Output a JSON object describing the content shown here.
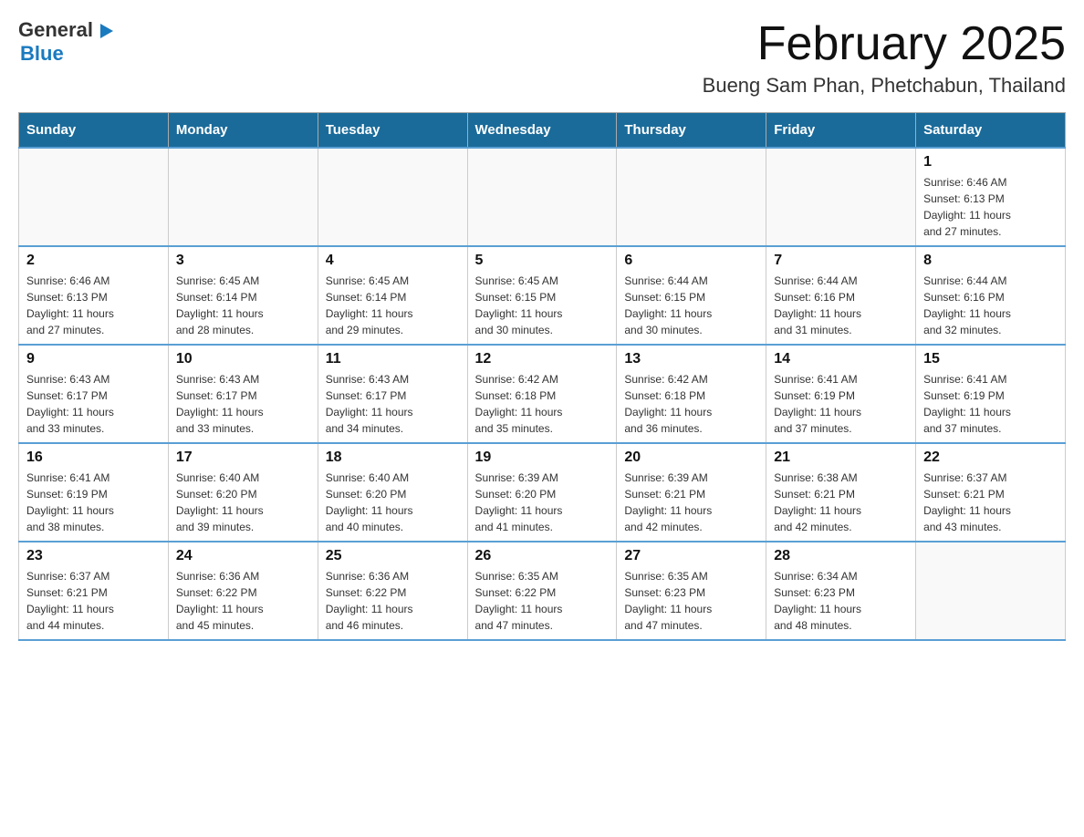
{
  "header": {
    "logo_general": "General",
    "logo_blue": "Blue",
    "month_title": "February 2025",
    "location": "Bueng Sam Phan, Phetchabun, Thailand"
  },
  "days_of_week": [
    "Sunday",
    "Monday",
    "Tuesday",
    "Wednesday",
    "Thursday",
    "Friday",
    "Saturday"
  ],
  "weeks": [
    [
      {
        "day": "",
        "info": ""
      },
      {
        "day": "",
        "info": ""
      },
      {
        "day": "",
        "info": ""
      },
      {
        "day": "",
        "info": ""
      },
      {
        "day": "",
        "info": ""
      },
      {
        "day": "",
        "info": ""
      },
      {
        "day": "1",
        "info": "Sunrise: 6:46 AM\nSunset: 6:13 PM\nDaylight: 11 hours\nand 27 minutes."
      }
    ],
    [
      {
        "day": "2",
        "info": "Sunrise: 6:46 AM\nSunset: 6:13 PM\nDaylight: 11 hours\nand 27 minutes."
      },
      {
        "day": "3",
        "info": "Sunrise: 6:45 AM\nSunset: 6:14 PM\nDaylight: 11 hours\nand 28 minutes."
      },
      {
        "day": "4",
        "info": "Sunrise: 6:45 AM\nSunset: 6:14 PM\nDaylight: 11 hours\nand 29 minutes."
      },
      {
        "day": "5",
        "info": "Sunrise: 6:45 AM\nSunset: 6:15 PM\nDaylight: 11 hours\nand 30 minutes."
      },
      {
        "day": "6",
        "info": "Sunrise: 6:44 AM\nSunset: 6:15 PM\nDaylight: 11 hours\nand 30 minutes."
      },
      {
        "day": "7",
        "info": "Sunrise: 6:44 AM\nSunset: 6:16 PM\nDaylight: 11 hours\nand 31 minutes."
      },
      {
        "day": "8",
        "info": "Sunrise: 6:44 AM\nSunset: 6:16 PM\nDaylight: 11 hours\nand 32 minutes."
      }
    ],
    [
      {
        "day": "9",
        "info": "Sunrise: 6:43 AM\nSunset: 6:17 PM\nDaylight: 11 hours\nand 33 minutes."
      },
      {
        "day": "10",
        "info": "Sunrise: 6:43 AM\nSunset: 6:17 PM\nDaylight: 11 hours\nand 33 minutes."
      },
      {
        "day": "11",
        "info": "Sunrise: 6:43 AM\nSunset: 6:17 PM\nDaylight: 11 hours\nand 34 minutes."
      },
      {
        "day": "12",
        "info": "Sunrise: 6:42 AM\nSunset: 6:18 PM\nDaylight: 11 hours\nand 35 minutes."
      },
      {
        "day": "13",
        "info": "Sunrise: 6:42 AM\nSunset: 6:18 PM\nDaylight: 11 hours\nand 36 minutes."
      },
      {
        "day": "14",
        "info": "Sunrise: 6:41 AM\nSunset: 6:19 PM\nDaylight: 11 hours\nand 37 minutes."
      },
      {
        "day": "15",
        "info": "Sunrise: 6:41 AM\nSunset: 6:19 PM\nDaylight: 11 hours\nand 37 minutes."
      }
    ],
    [
      {
        "day": "16",
        "info": "Sunrise: 6:41 AM\nSunset: 6:19 PM\nDaylight: 11 hours\nand 38 minutes."
      },
      {
        "day": "17",
        "info": "Sunrise: 6:40 AM\nSunset: 6:20 PM\nDaylight: 11 hours\nand 39 minutes."
      },
      {
        "day": "18",
        "info": "Sunrise: 6:40 AM\nSunset: 6:20 PM\nDaylight: 11 hours\nand 40 minutes."
      },
      {
        "day": "19",
        "info": "Sunrise: 6:39 AM\nSunset: 6:20 PM\nDaylight: 11 hours\nand 41 minutes."
      },
      {
        "day": "20",
        "info": "Sunrise: 6:39 AM\nSunset: 6:21 PM\nDaylight: 11 hours\nand 42 minutes."
      },
      {
        "day": "21",
        "info": "Sunrise: 6:38 AM\nSunset: 6:21 PM\nDaylight: 11 hours\nand 42 minutes."
      },
      {
        "day": "22",
        "info": "Sunrise: 6:37 AM\nSunset: 6:21 PM\nDaylight: 11 hours\nand 43 minutes."
      }
    ],
    [
      {
        "day": "23",
        "info": "Sunrise: 6:37 AM\nSunset: 6:21 PM\nDaylight: 11 hours\nand 44 minutes."
      },
      {
        "day": "24",
        "info": "Sunrise: 6:36 AM\nSunset: 6:22 PM\nDaylight: 11 hours\nand 45 minutes."
      },
      {
        "day": "25",
        "info": "Sunrise: 6:36 AM\nSunset: 6:22 PM\nDaylight: 11 hours\nand 46 minutes."
      },
      {
        "day": "26",
        "info": "Sunrise: 6:35 AM\nSunset: 6:22 PM\nDaylight: 11 hours\nand 47 minutes."
      },
      {
        "day": "27",
        "info": "Sunrise: 6:35 AM\nSunset: 6:23 PM\nDaylight: 11 hours\nand 47 minutes."
      },
      {
        "day": "28",
        "info": "Sunrise: 6:34 AM\nSunset: 6:23 PM\nDaylight: 11 hours\nand 48 minutes."
      },
      {
        "day": "",
        "info": ""
      }
    ]
  ]
}
